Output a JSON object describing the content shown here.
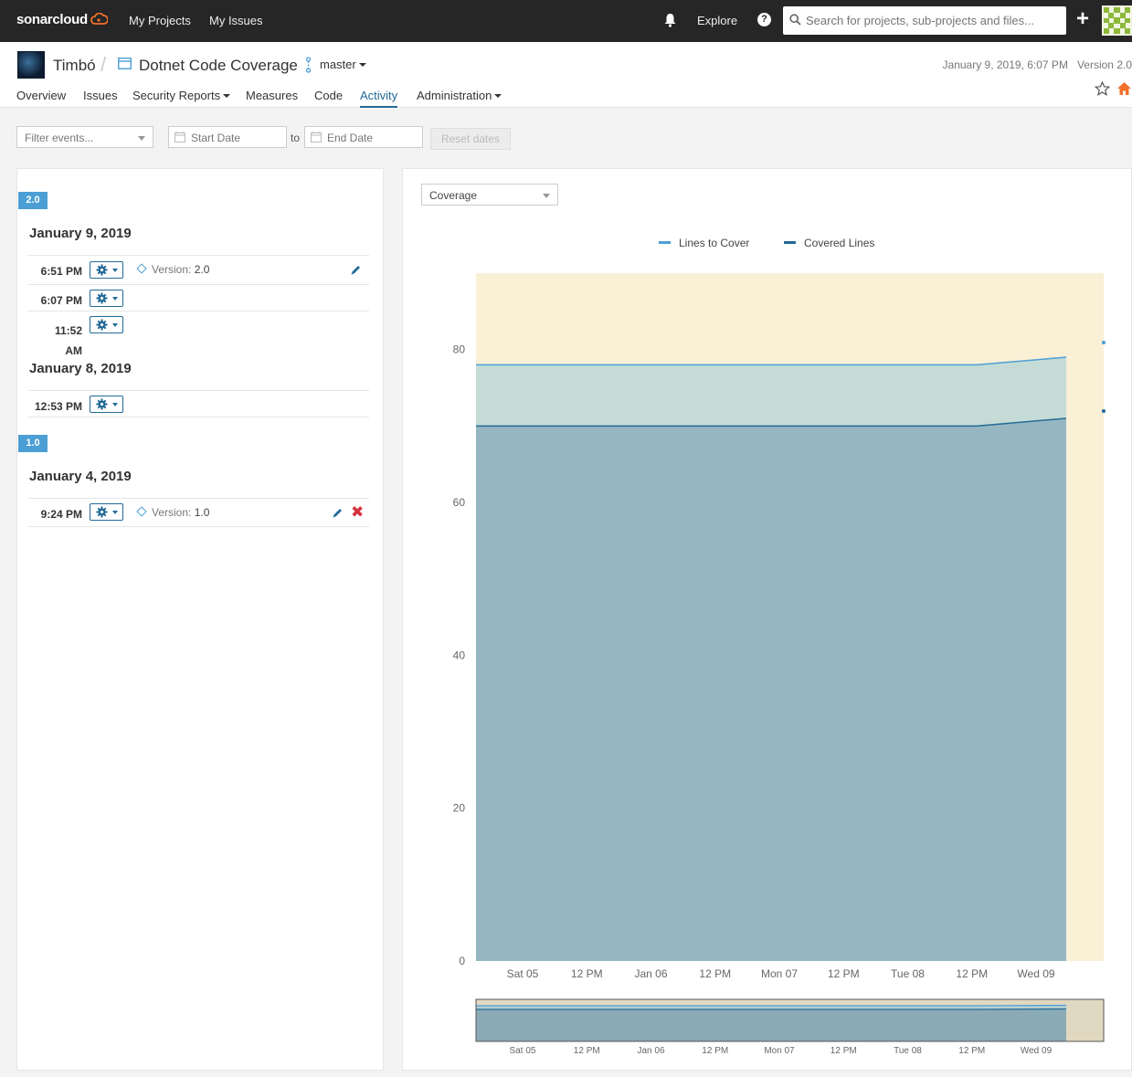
{
  "topbar": {
    "logo": "sonarcloud",
    "nav": [
      "My Projects",
      "My Issues"
    ],
    "explore": "Explore",
    "help_symbol": "?",
    "search_placeholder": "Search for projects, sub-projects and files...",
    "plus_symbol": "+"
  },
  "project": {
    "organization": "Timbó",
    "name": "Dotnet Code Coverage",
    "branch": "master",
    "last_analysis": "January 9, 2019, 6:07 PM",
    "version": "Version 2.0",
    "tabs": [
      "Overview",
      "Issues",
      "Security Reports",
      "Measures",
      "Code",
      "Activity",
      "Administration"
    ],
    "active_tab": "Activity"
  },
  "filters": {
    "events_placeholder": "Filter events...",
    "start_date_placeholder": "Start Date",
    "to_label": "to",
    "end_date_placeholder": "End Date",
    "reset_label": "Reset dates"
  },
  "timeline": {
    "version_prefix": "Version:",
    "groups": [
      {
        "version": "2.0",
        "days": [
          {
            "date": "January 9, 2019",
            "events": [
              {
                "time": "6:51 PM",
                "version": "2.0"
              },
              {
                "time": "6:07 PM"
              },
              {
                "time": "11:52 AM"
              }
            ]
          },
          {
            "date": "January 8, 2019",
            "events": [
              {
                "time": "12:53 PM"
              }
            ]
          }
        ]
      },
      {
        "version": "1.0",
        "days": [
          {
            "date": "January 4, 2019",
            "events": [
              {
                "time": "9:24 PM",
                "version": "1.0"
              }
            ]
          }
        ]
      }
    ]
  },
  "graph": {
    "selected": "Coverage",
    "colors": {
      "lines_to_cover": "#4b9fd5",
      "covered_lines": "#236a97",
      "future_band": "#f9f0d6"
    }
  },
  "chart_data": {
    "type": "area",
    "x_ticks": [
      "Sat 05",
      "12 PM",
      "Jan 06",
      "12 PM",
      "Mon 07",
      "12 PM",
      "Tue 08",
      "12 PM",
      "Wed 09"
    ],
    "y_ticks": [
      0,
      20,
      40,
      60,
      80
    ],
    "ylim": [
      0,
      90
    ],
    "legend": "top-center",
    "series": [
      {
        "name": "Lines to Cover",
        "x": [
          "Jan 04 21:24",
          "Jan 08 12:53",
          "Jan 09 18:51"
        ],
        "values": [
          78,
          78,
          79
        ]
      },
      {
        "name": "Covered Lines",
        "x": [
          "Jan 04 21:24",
          "Jan 08 12:53",
          "Jan 09 18:51"
        ],
        "values": [
          70,
          70,
          71
        ]
      }
    ]
  }
}
